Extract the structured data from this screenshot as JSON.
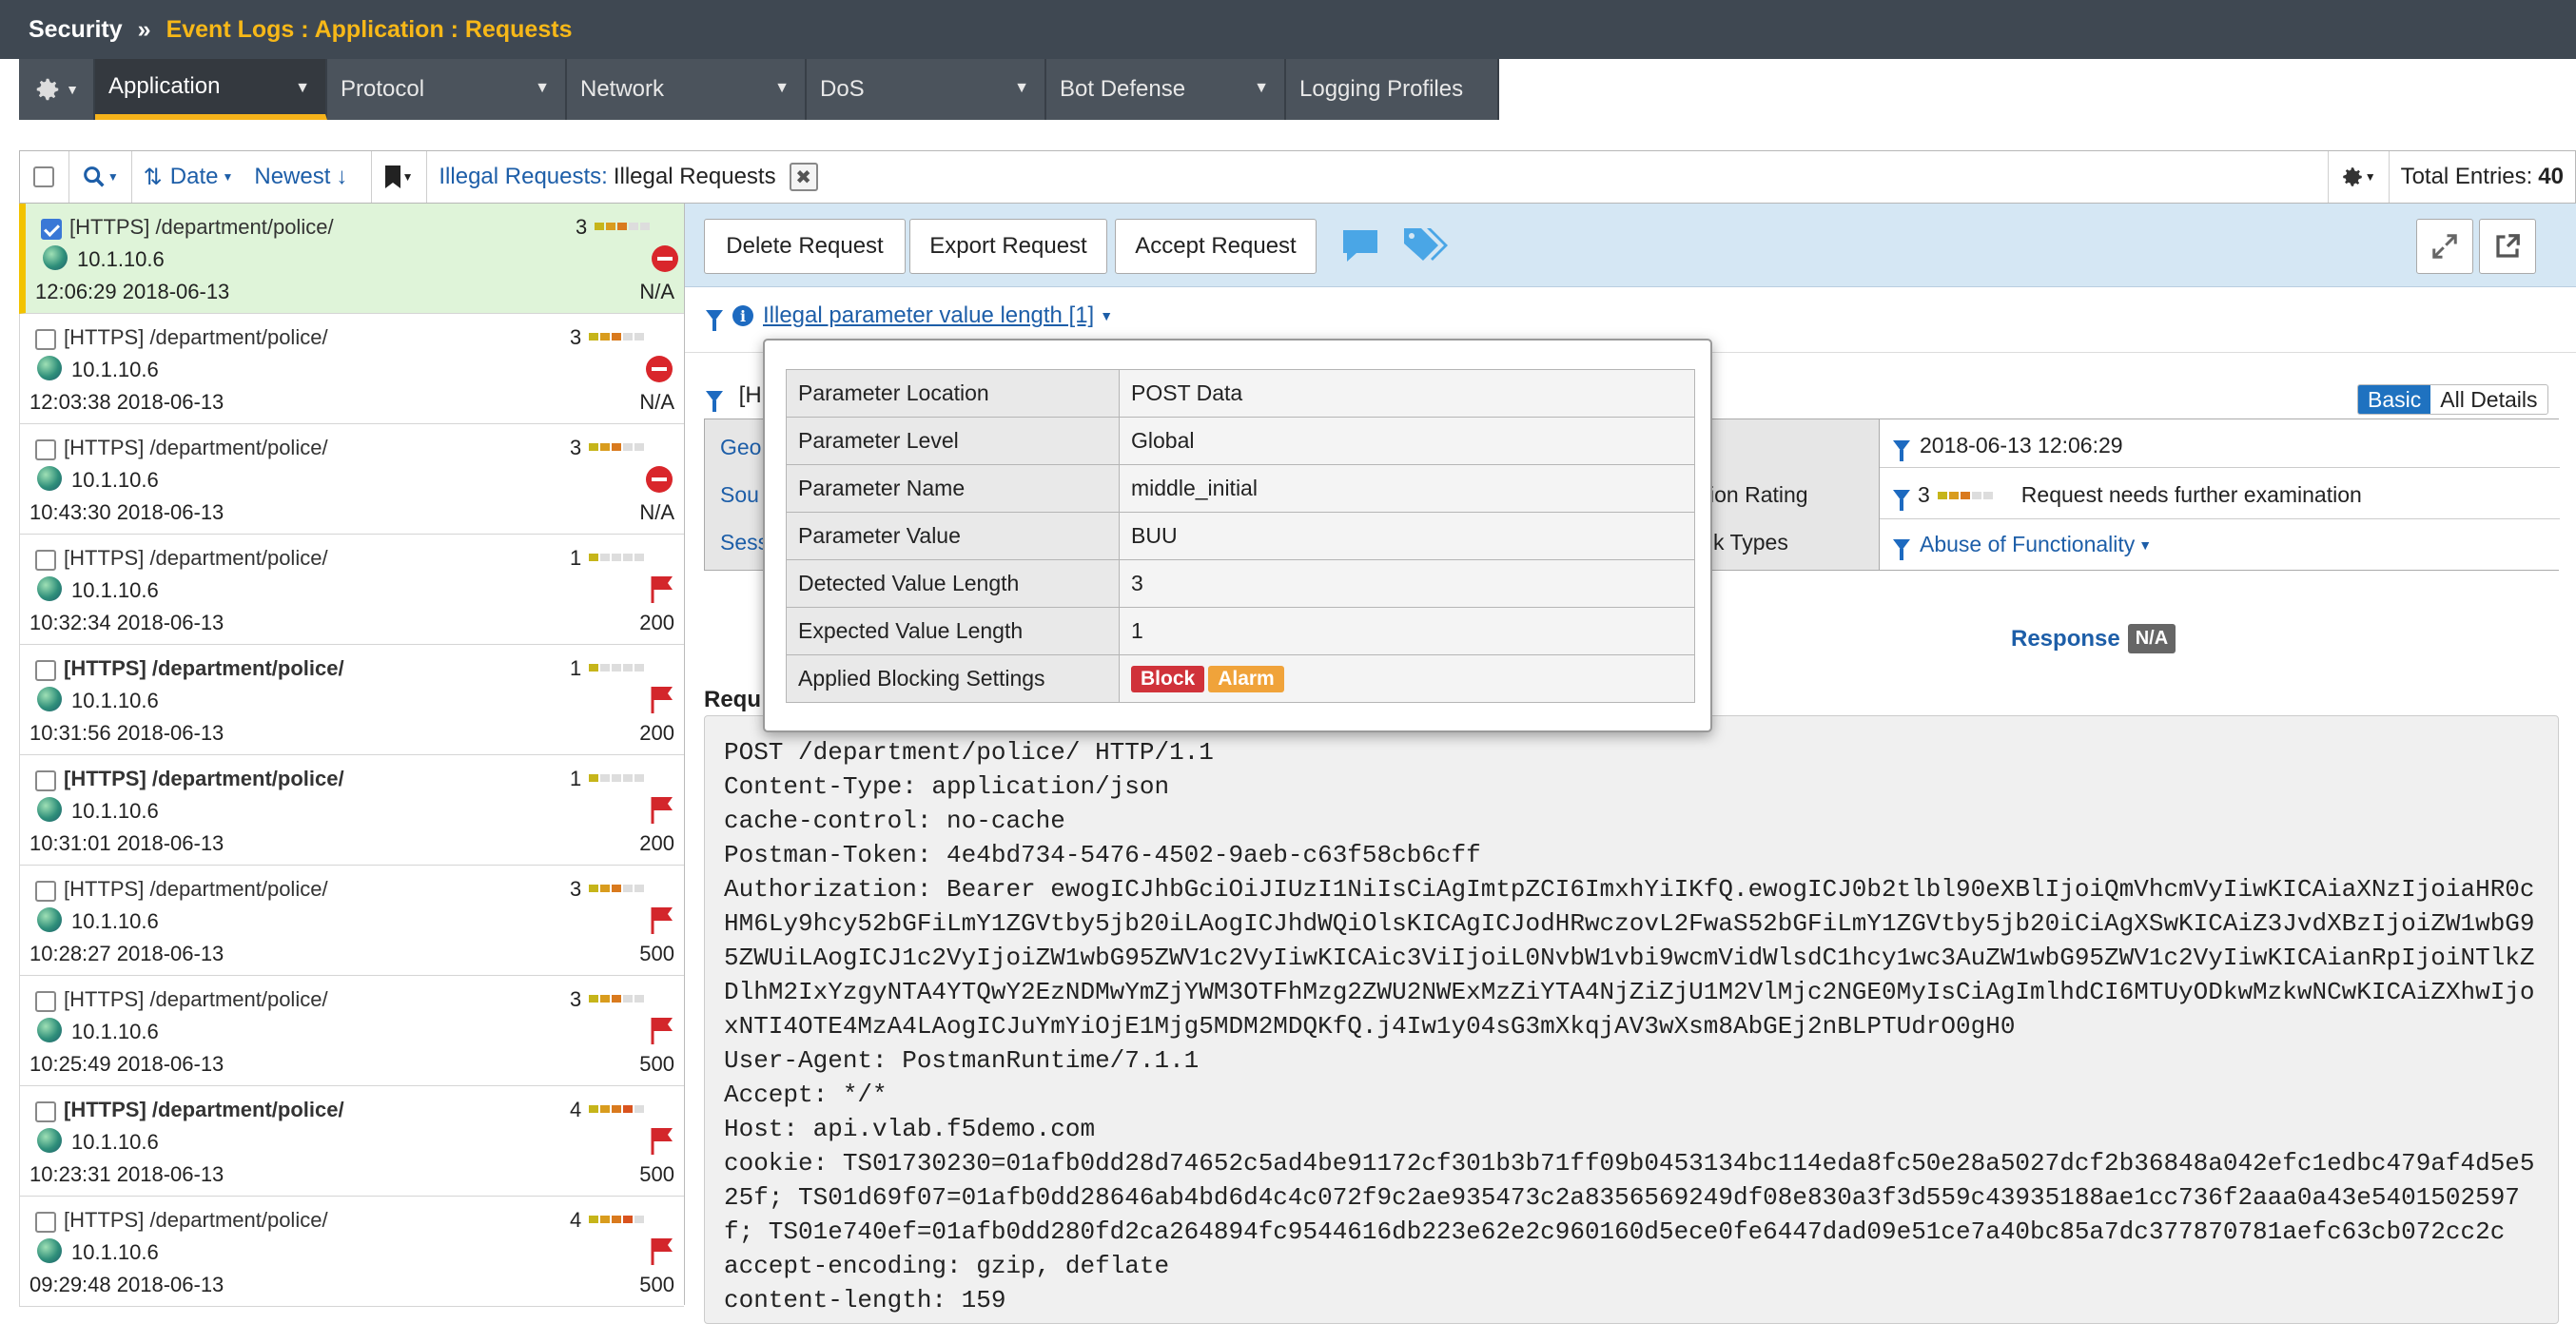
{
  "header": {
    "security": "Security",
    "separator": "»",
    "path": "Event Logs : Application : Requests"
  },
  "tabs": [
    "Application",
    "Protocol",
    "Network",
    "DoS",
    "Bot Defense",
    "Logging Profiles"
  ],
  "toolbar": {
    "sort_label": "Date",
    "order_label": "Newest",
    "filter_prefix": "Illegal Requests:",
    "filter_value": "Illegal Requests",
    "total_label": "Total Entries:",
    "total_value": "40"
  },
  "requests": [
    {
      "url": "[HTTPS] /department/police/",
      "ip": "10.1.10.6",
      "time": "12:06:29 2018-06-13",
      "rating": "3",
      "status": "N/A",
      "bold": false
    },
    {
      "url": "[HTTPS] /department/police/",
      "ip": "10.1.10.6",
      "time": "12:03:38 2018-06-13",
      "rating": "3",
      "status": "N/A",
      "bold": false
    },
    {
      "url": "[HTTPS] /department/police/",
      "ip": "10.1.10.6",
      "time": "10:43:30 2018-06-13",
      "rating": "3",
      "status": "N/A",
      "bold": false
    },
    {
      "url": "[HTTPS] /department/police/",
      "ip": "10.1.10.6",
      "time": "10:32:34 2018-06-13",
      "rating": "1",
      "status": "200",
      "bold": false
    },
    {
      "url": "[HTTPS] /department/police/",
      "ip": "10.1.10.6",
      "time": "10:31:56 2018-06-13",
      "rating": "1",
      "status": "200",
      "bold": true
    },
    {
      "url": "[HTTPS] /department/police/",
      "ip": "10.1.10.6",
      "time": "10:31:01 2018-06-13",
      "rating": "1",
      "status": "200",
      "bold": true
    },
    {
      "url": "[HTTPS] /department/police/",
      "ip": "10.1.10.6",
      "time": "10:28:27 2018-06-13",
      "rating": "3",
      "status": "500",
      "bold": false
    },
    {
      "url": "[HTTPS] /department/police/",
      "ip": "10.1.10.6",
      "time": "10:25:49 2018-06-13",
      "rating": "3",
      "status": "500",
      "bold": false
    },
    {
      "url": "[HTTPS] /department/police/",
      "ip": "10.1.10.6",
      "time": "10:23:31 2018-06-13",
      "rating": "4",
      "status": "500",
      "bold": true
    },
    {
      "url": "[HTTPS] /department/police/",
      "ip": "10.1.10.6",
      "time": "09:29:48 2018-06-13",
      "rating": "4",
      "status": "500",
      "bold": false
    }
  ],
  "actions": {
    "delete": "Delete Request",
    "export": "Export Request",
    "accept": "Accept Request"
  },
  "violation": {
    "link": "Illegal parameter value length [1]"
  },
  "details": {
    "header_partial": "[H",
    "basic": "Basic",
    "all": "All Details",
    "left_labels": [
      "Geo",
      "Sou",
      "Sess"
    ],
    "right_labels": [
      "ion Rating",
      "k Types"
    ],
    "time_value": "2018-06-13 12:06:29",
    "rating_num": "3",
    "rating_text": "Request needs further examination",
    "attack_type": "Abuse of Functionality"
  },
  "response": {
    "label": "Response",
    "value": "N/A"
  },
  "request": {
    "label": "Requ",
    "lines": [
      "POST /department/police/ HTTP/1.1",
      "Content-Type: application/json",
      "cache-control: no-cache",
      "Postman-Token: 4e4bd734-5476-4502-9aeb-c63f58cb6cff",
      "Authorization: Bearer ewogICJhbGciOiJIUzI1NiIsCiAgImtpZCI6ImxhYiIKfQ.ewogICJ0b2tlbl90eXBlIjoiQmVhcmVyIiwKICAiaXNzIjoiaHR0cHM6Ly9hcy52bGFiLmY1ZGVtby5jb20iLAogICJhdWQiOlsKICAgICJodHRwczovL2FwaS52bGFiLmY1ZGVtby5jb20iCiAgXSwKICAiZ3JvdXBzIjoiZW1wbG95ZWUiLAogICJ1c2VyIjoiZW1wbG95ZWV1c2VyIiwKICAic3ViIjoiL0NvbW1vbi9wcmVidWlsdC1hcy1wc3AuZW1wbG95ZWV1c2VyIiwKICAianRpIjoiNTlkZDlhM2IxYzgyNTA4YTQwY2EzNDMwYmZjYWM3OTFhMzg2ZWU2NWExMzZiYTA4NjZiZjU1M2VlMjc2NGE0MyIsCiAgImlhdCI6MTUyODkwMzkwNCwKICAiZXhwIjoxNTI4OTE4MzA4LAogICJuYmYiOjE1Mjg5MDM2MDQKfQ.j4Iw1y04sG3mXkqjAV3wXsm8AbGEj2nBLPTUdrO0gH0",
      "User-Agent: PostmanRuntime/7.1.1",
      "Accept: */*",
      "Host: api.vlab.f5demo.com",
      "cookie: TS01730230=01afb0dd28d74652c5ad4be91172cf301b3b71ff09b0453134bc114eda8fc50e28a5027dcf2b36848a042efc1edbc479af4d5e525f; TS01d69f07=01afb0dd28646ab4bd6d4c4c072f9c2ae935473c2a8356569249df08e830a3f3d559c43935188ae1cc736f2aaa0a43e5401502597f; TS01e740ef=01afb0dd280fd2ca264894fc9544616db223e62e2c960160d5ece0fe6447dad09e51ce7a40bc85a7dc377870781aefc63cb072cc2c",
      "accept-encoding: gzip, deflate",
      "content-length: 159"
    ]
  },
  "popup": {
    "rows": [
      {
        "k": "Parameter Location",
        "v": "POST Data"
      },
      {
        "k": "Parameter Level",
        "v": "Global"
      },
      {
        "k": "Parameter Name",
        "v": "middle_initial"
      },
      {
        "k": "Parameter Value",
        "v": "BUU"
      },
      {
        "k": "Detected Value Length",
        "v": "3"
      },
      {
        "k": "Expected Value Length",
        "v": "1"
      }
    ],
    "blocking_label": "Applied Blocking Settings",
    "block": "Block",
    "alarm": "Alarm"
  },
  "colors": {
    "accent": "#f6b31a",
    "link": "#1d5ea8",
    "block": "#d0323a",
    "alarm": "#f0a33a",
    "selected_row": "#dff4d9"
  }
}
